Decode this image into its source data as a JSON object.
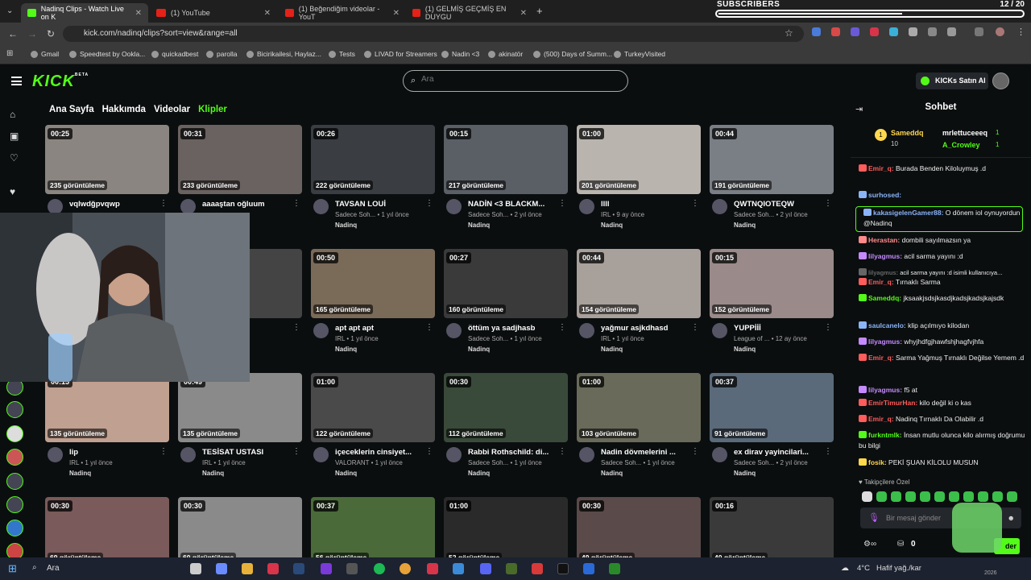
{
  "browser": {
    "tabs": [
      {
        "label": "Nadinq Clips - Watch Live on K"
      },
      {
        "label": "(1) YouTube"
      },
      {
        "label": "(1) Beğendiğim videolar - YouT"
      },
      {
        "label": "(1) GELMİŞ GEÇMİŞ EN DUYGU"
      }
    ],
    "url": "kick.com/nadinq/clips?sort=view&range=all",
    "bookmarks": [
      "Gmail",
      "Speedtest by Ookla...",
      "quickadbest",
      "parolla",
      "Bicirikailesi, Haylaz...",
      "Tests",
      "LIVAD for Streamers",
      "Nadin <3",
      "akinatör",
      "(500) Days of Summ...",
      "TurkeyVisited"
    ]
  },
  "overlay": {
    "subs_title": "SUBSCRIBERS",
    "subs_count": "12 / 20",
    "subs_progress": 0.6
  },
  "header": {
    "logo": "KICK",
    "logo_beta": "BETA",
    "search_placeholder": "Ara",
    "kicks_button": "KICKs Satın Al"
  },
  "profile_tabs": [
    "Ana Sayfa",
    "Hakkımda",
    "Videolar",
    "Klipler"
  ],
  "clips": [
    {
      "duration": "00:25",
      "views": "235 görüntüleme",
      "title": "vqlwdğpvqwp",
      "meta": "",
      "author": ""
    },
    {
      "duration": "00:31",
      "views": "233 görüntüleme",
      "title": "aaaaştan oğluum",
      "meta": "",
      "author": ""
    },
    {
      "duration": "00:26",
      "views": "222 görüntüleme",
      "title": "TAVSAN LOUİ",
      "meta": "Sadece Soh... • 1 yıl önce",
      "author": "Nadinq"
    },
    {
      "duration": "00:15",
      "views": "217 görüntüleme",
      "title": "NADİN <3 BLACKM...",
      "meta": "Sadece Soh... • 2 yıl önce",
      "author": "Nadinq"
    },
    {
      "duration": "01:00",
      "views": "201 görüntüleme",
      "title": "llll",
      "meta": "IRL • 9 ay önce",
      "author": "Nadinq"
    },
    {
      "duration": "00:44",
      "views": "191 görüntüleme",
      "title": "QWTNQIOTEQW",
      "meta": "Sadece Soh... • 2 yıl önce",
      "author": "Nadinq"
    },
    {
      "duration": "",
      "views": "",
      "title": "",
      "meta": "",
      "author": ""
    },
    {
      "duration": "",
      "views": "",
      "title": "ramad...",
      "meta": "11 ay önce",
      "author": ""
    },
    {
      "duration": "00:50",
      "views": "165 görüntüleme",
      "title": "apt apt apt",
      "meta": "IRL • 1 yıl önce",
      "author": "Nadinq"
    },
    {
      "duration": "00:27",
      "views": "160 görüntüleme",
      "title": "öttüm ya sadjhasb",
      "meta": "Sadece Soh... • 1 yıl önce",
      "author": "Nadinq"
    },
    {
      "duration": "00:44",
      "views": "154 görüntüleme",
      "title": "yağmur asjkdhasd",
      "meta": "IRL • 1 yıl önce",
      "author": "Nadinq"
    },
    {
      "duration": "00:15",
      "views": "152 görüntüleme",
      "title": "YUPPİİİ",
      "meta": "League of ... • 12 ay önce",
      "author": "Nadinq"
    },
    {
      "duration": "00:15",
      "views": "135 görüntüleme",
      "title": "lip",
      "meta": "IRL • 1 yıl önce",
      "author": "Nadinq"
    },
    {
      "duration": "00:49",
      "views": "135 görüntüleme",
      "title": "TESİSAT USTASI",
      "meta": "IRL • 1 yıl önce",
      "author": "Nadinq"
    },
    {
      "duration": "01:00",
      "views": "122 görüntüleme",
      "title": "içeceklerin cinsiyet...",
      "meta": "VALORANT • 1 yıl önce",
      "author": "Nadinq"
    },
    {
      "duration": "00:30",
      "views": "112 görüntüleme",
      "title": "Rabbi Rothschild: di...",
      "meta": "Sadece Soh... • 1 yıl önce",
      "author": "Nadinq"
    },
    {
      "duration": "01:00",
      "views": "103 görüntüleme",
      "title": "Nadin dövmelerini ...",
      "meta": "Sadece Soh... • 1 yıl önce",
      "author": "Nadinq"
    },
    {
      "duration": "00:37",
      "views": "91 görüntüleme",
      "title": "ex dirav yayincilari...",
      "meta": "Sadece Soh... • 2 yıl önce",
      "author": "Nadinq"
    },
    {
      "duration": "00:30",
      "views": "69 görüntüleme",
      "title": "",
      "meta": "",
      "author": ""
    },
    {
      "duration": "00:30",
      "views": "60 görüntüleme",
      "title": "",
      "meta": "",
      "author": ""
    },
    {
      "duration": "00:37",
      "views": "56 görüntüleme",
      "title": "",
      "meta": "",
      "author": ""
    },
    {
      "duration": "01:00",
      "views": "52 görüntüleme",
      "title": "",
      "meta": "",
      "author": ""
    },
    {
      "duration": "00:30",
      "views": "49 görüntüleme",
      "title": "",
      "meta": "",
      "author": ""
    },
    {
      "duration": "00:16",
      "views": "40 görüntüleme",
      "title": "",
      "meta": "",
      "author": ""
    }
  ],
  "chat": {
    "title": "Sohbet",
    "pinned": [
      {
        "user": "Sameddq",
        "count": "10"
      },
      {
        "user": "mrlettuceeeq",
        "count": "1"
      },
      {
        "user": "A_Crowley",
        "count": "1"
      }
    ],
    "messages": [
      {
        "user": "Emir_q:",
        "text": "Burada Benden Kiloluymuş .d",
        "color": "#ff5c5c"
      },
      {
        "user": "surhosed:",
        "text": "",
        "color": "#8ab4f8"
      },
      {
        "user": "kakasigelenGamer88:",
        "text": "O dönem iol oynuyordun @Nadinq",
        "color": "#8ab4f8"
      },
      {
        "user": "Herastan:",
        "text": "dombili sayılmazsın ya",
        "color": "#ff8a8a"
      },
      {
        "user": "lilyagmus:",
        "text": "acil sarma yayını :d",
        "color": "#c58aff"
      },
      {
        "user": "lilyagmus:",
        "text": "acil sarma yayını :d isimli kullanıcıya...",
        "color": "#666666"
      },
      {
        "user": "Emir_q:",
        "text": "Tırnaklı Sarma",
        "color": "#ff5c5c"
      },
      {
        "user": "Sameddq:",
        "text": "jksaakjsdsjkasdjkadsjkadsjkajsdk",
        "color": "#53fc18"
      },
      {
        "user": "saulcanelo:",
        "text": "klip açılmıyo kilodan",
        "color": "#8ab4f8"
      },
      {
        "user": "lilyagmus:",
        "text": "whyjhdfgjhawfshjhagfvjhfa",
        "color": "#c58aff"
      },
      {
        "user": "Emir_q:",
        "text": "Sarma Yağmuş Tırnaklı Değilse Yemem .d",
        "color": "#ff5c5c"
      },
      {
        "user": "lilyagmus:",
        "text": "f5 at",
        "color": "#c58aff"
      },
      {
        "user": "EmirTimurHan:",
        "text": "kilo değil ki o kas",
        "color": "#ff5c5c"
      },
      {
        "user": "Emir_q:",
        "text": "Nadinq Tırnaklı Da Olabilir .d",
        "color": "#ff5c5c"
      },
      {
        "user": "furkntmlk:",
        "text": "İnsan mutlu olunca kilo alırmış doğrumu bu bilgi",
        "color": "#53fc18"
      },
      {
        "user": "fosik:",
        "text": "PEKİ ŞUAN KİLOLU MUSUN",
        "color": "#ffd84d"
      }
    ],
    "emote_label": "Takipçilere Özel",
    "input_placeholder": "Bir mesaj gönder",
    "send_label": "der",
    "points": "0"
  },
  "taskbar": {
    "search": "Ara",
    "weather": "4°C",
    "weather_text": "Hafif yağ./kar",
    "year": "2026"
  }
}
